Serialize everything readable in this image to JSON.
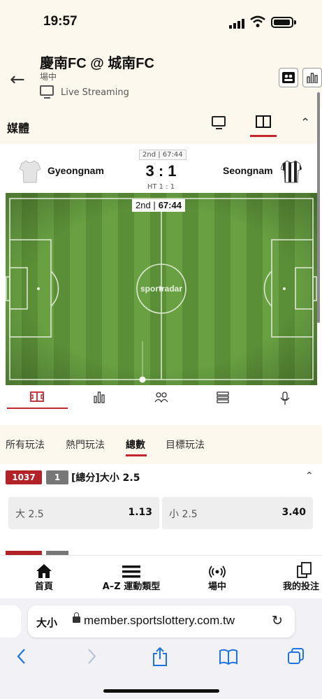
{
  "status_bar": {
    "time": "19:57"
  },
  "header": {
    "title": "慶南FC @ 城南FC",
    "status": "場中",
    "live_streaming": "Live Streaming"
  },
  "media": {
    "label": "媒體"
  },
  "scoreboard": {
    "period_chip": "2nd | 67:44",
    "home_team": "Gyeongnam",
    "away_team": "Seongnam",
    "score": "3 : 1",
    "halftime": "HT 1 : 1",
    "clock_period": "2nd",
    "clock_time": "67:44",
    "brand": "sportradar"
  },
  "market_tabs": [
    "所有玩法",
    "熱門玩法",
    "總數",
    "目標玩法"
  ],
  "market": {
    "id_badge": "1037",
    "num_badge": "1",
    "title": "[總分]大小 2.5",
    "options": [
      {
        "label": "大 2.5",
        "odds": "1.13"
      },
      {
        "label": "小 2.5",
        "odds": "3.40"
      }
    ]
  },
  "bottom_nav": [
    {
      "label": "首頁",
      "icon": "home-icon"
    },
    {
      "label": "A–Z 運動類型",
      "icon": "menu-icon"
    },
    {
      "label": "場中",
      "icon": "live-icon"
    },
    {
      "label": "我的投注",
      "icon": "copy-icon"
    }
  ],
  "browser": {
    "text_size": "大小",
    "url": "member.sportslottery.com.tw"
  },
  "colors": {
    "accent": "#c4262c",
    "cream": "#fdf8ee",
    "pitch": "#5b8f37"
  }
}
